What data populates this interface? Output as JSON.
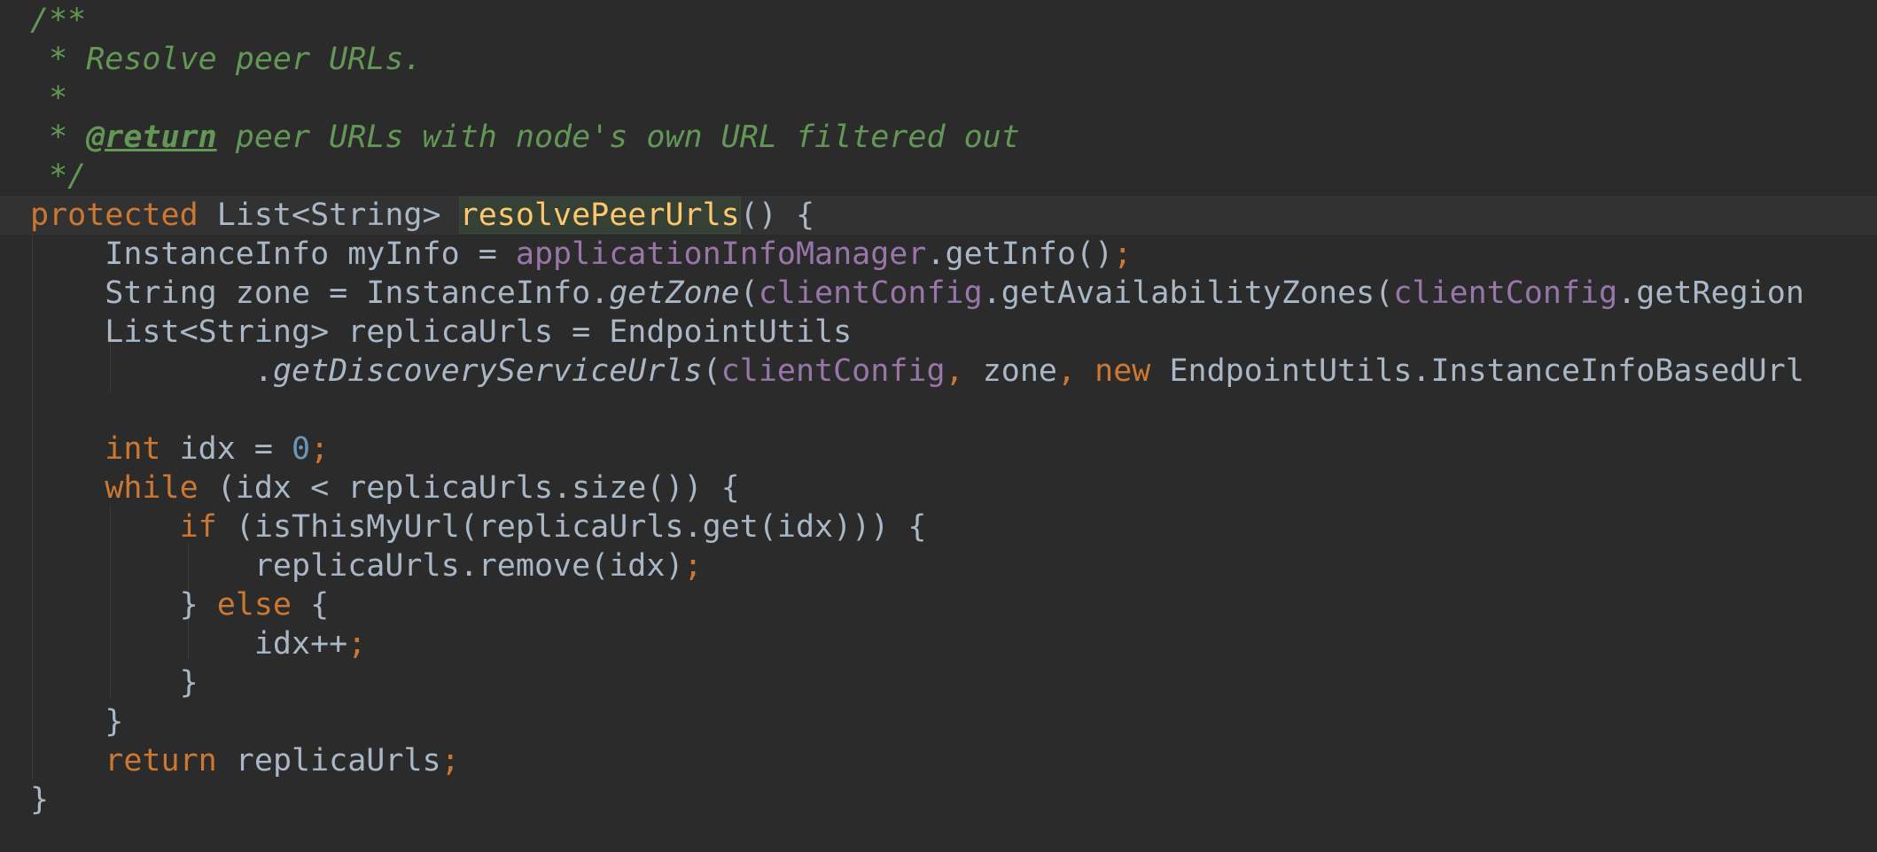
{
  "editor": {
    "theme": "Darcula",
    "colors": {
      "background": "#2b2b2b",
      "current_line": "#323232",
      "keyword": "#cc7832",
      "plain": "#a9b7c6",
      "field": "#9876aa",
      "number": "#6897bb",
      "doc_comment": "#629755",
      "method_declaration": "#ffc66d"
    },
    "lines": [
      [
        {
          "t": "comment",
          "v": "/**"
        }
      ],
      [
        {
          "t": "comment",
          "v": " * Resolve peer URLs."
        }
      ],
      [
        {
          "t": "comment",
          "v": " *"
        }
      ],
      [
        {
          "t": "comment",
          "v": " * "
        },
        {
          "t": "doctag",
          "v": "@return"
        },
        {
          "t": "comment",
          "v": " peer URLs with node's own URL filtered out"
        }
      ],
      [
        {
          "t": "comment",
          "v": " */"
        }
      ],
      [
        {
          "t": "kw",
          "v": "protected "
        },
        {
          "t": "plain",
          "v": "List<String> "
        },
        {
          "t": "method-hl",
          "v": "resolvePeerUrls"
        },
        {
          "t": "plain",
          "v": "() {"
        }
      ],
      [
        {
          "t": "plain",
          "v": "    InstanceInfo myInfo = "
        },
        {
          "t": "field",
          "v": "applicationInfoManager"
        },
        {
          "t": "plain",
          "v": ".getInfo()"
        },
        {
          "t": "punct",
          "v": ";"
        }
      ],
      [
        {
          "t": "plain",
          "v": "    String zone = InstanceInfo."
        },
        {
          "t": "static",
          "v": "getZone"
        },
        {
          "t": "plain",
          "v": "("
        },
        {
          "t": "field",
          "v": "clientConfig"
        },
        {
          "t": "plain",
          "v": ".getAvailabilityZones("
        },
        {
          "t": "field",
          "v": "clientConfig"
        },
        {
          "t": "plain",
          "v": ".getRegion"
        }
      ],
      [
        {
          "t": "plain",
          "v": "    List<String> replicaUrls = EndpointUtils"
        }
      ],
      [
        {
          "t": "plain",
          "v": "            ."
        },
        {
          "t": "static",
          "v": "getDiscoveryServiceUrls"
        },
        {
          "t": "plain",
          "v": "("
        },
        {
          "t": "field",
          "v": "clientConfig"
        },
        {
          "t": "punct",
          "v": ", "
        },
        {
          "t": "plain",
          "v": "zone"
        },
        {
          "t": "punct",
          "v": ", "
        },
        {
          "t": "kw",
          "v": "new "
        },
        {
          "t": "plain",
          "v": "EndpointUtils.InstanceInfoBasedUrl"
        }
      ],
      [],
      [
        {
          "t": "kw",
          "v": "    int "
        },
        {
          "t": "plain",
          "v": "idx = "
        },
        {
          "t": "num",
          "v": "0"
        },
        {
          "t": "punct",
          "v": ";"
        }
      ],
      [
        {
          "t": "kw",
          "v": "    while "
        },
        {
          "t": "plain",
          "v": "(idx < replicaUrls.size()) {"
        }
      ],
      [
        {
          "t": "kw",
          "v": "        if "
        },
        {
          "t": "plain",
          "v": "(isThisMyUrl(replicaUrls.get(idx))) {"
        }
      ],
      [
        {
          "t": "plain",
          "v": "            replicaUrls.remove(idx)"
        },
        {
          "t": "punct",
          "v": ";"
        }
      ],
      [
        {
          "t": "plain",
          "v": "        } "
        },
        {
          "t": "kw",
          "v": "else "
        },
        {
          "t": "plain",
          "v": "{"
        }
      ],
      [
        {
          "t": "plain",
          "v": "            idx++"
        },
        {
          "t": "punct",
          "v": ";"
        }
      ],
      [
        {
          "t": "plain",
          "v": "        }"
        }
      ],
      [
        {
          "t": "plain",
          "v": "    }"
        }
      ],
      [
        {
          "t": "kw",
          "v": "    return "
        },
        {
          "t": "plain",
          "v": "replicaUrls"
        },
        {
          "t": "punct",
          "v": ";"
        }
      ],
      [
        {
          "t": "plain",
          "v": "}"
        }
      ]
    ],
    "current_line_index": 5
  }
}
